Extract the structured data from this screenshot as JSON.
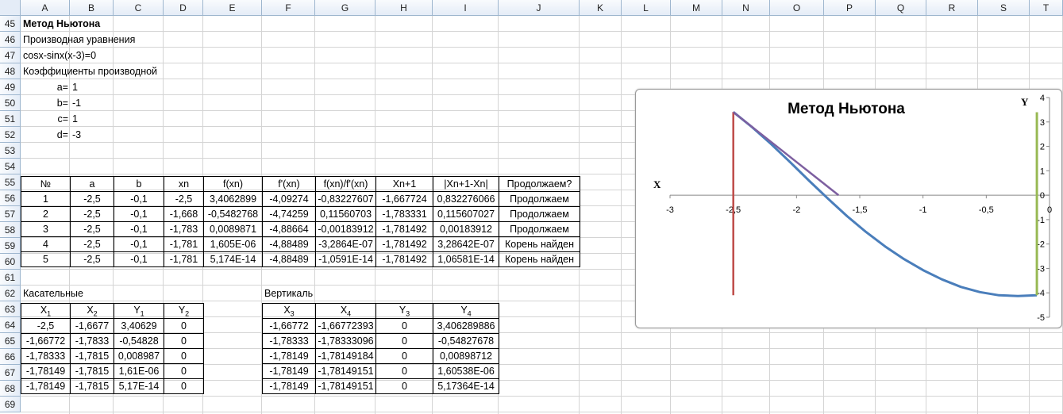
{
  "columns": [
    "A",
    "B",
    "C",
    "D",
    "E",
    "F",
    "G",
    "H",
    "I",
    "J",
    "K",
    "L",
    "M",
    "N",
    "O",
    "P",
    "Q",
    "R",
    "S",
    "T"
  ],
  "rows": [
    "45",
    "46",
    "47",
    "48",
    "49",
    "50",
    "51",
    "52",
    "53",
    "54",
    "55",
    "56",
    "57",
    "58",
    "59",
    "60",
    "61",
    "62",
    "63",
    "64",
    "65",
    "66",
    "67",
    "68",
    "69"
  ],
  "title": "Метод Ньютона",
  "derivative_label": "Производная уравнения",
  "equation": "cosx-sinx(x-3)=0",
  "coef_label": "Коэффициенты производной",
  "coefs": [
    {
      "name": "a=",
      "value": "1"
    },
    {
      "name": "b=",
      "value": "-1"
    },
    {
      "name": "c=",
      "value": "1"
    },
    {
      "name": "d=",
      "value": "-3"
    }
  ],
  "main_table": {
    "headers": [
      "№",
      "a",
      "b",
      "xn",
      "f(xn)",
      "f'(xn)",
      "f(xn)/f'(xn)",
      "Xn+1",
      "|Xn+1-Xn|",
      "Продолжаем?"
    ],
    "rows": [
      [
        "1",
        "-2,5",
        "-0,1",
        "-2,5",
        "3,4062899",
        "-4,09274",
        "-0,83227607",
        "-1,667724",
        "0,832276066",
        "Продолжаем"
      ],
      [
        "2",
        "-2,5",
        "-0,1",
        "-1,668",
        "-0,5482768",
        "-4,74259",
        "0,11560703",
        "-1,783331",
        "0,115607027",
        "Продолжаем"
      ],
      [
        "3",
        "-2,5",
        "-0,1",
        "-1,783",
        "0,0089871",
        "-4,88664",
        "-0,00183912",
        "-1,781492",
        "0,00183912",
        "Продолжаем"
      ],
      [
        "4",
        "-2,5",
        "-0,1",
        "-1,781",
        "1,605E-06",
        "-4,88489",
        "-3,2864E-07",
        "-1,781492",
        "3,28642E-07",
        "Корень найден"
      ],
      [
        "5",
        "-2,5",
        "-0,1",
        "-1,781",
        "5,174E-14",
        "-4,88489",
        "-1,0591E-14",
        "-1,781492",
        "1,06581E-14",
        "Корень найден"
      ]
    ]
  },
  "tangent_label": "Касательные",
  "tangent_table": {
    "headers": [
      [
        "X",
        "1"
      ],
      [
        "X",
        "2"
      ],
      [
        "Y",
        "1"
      ],
      [
        "Y",
        "2"
      ]
    ],
    "rows": [
      [
        "-2,5",
        "-1,6677",
        "3,40629",
        "0"
      ],
      [
        "-1,66772",
        "-1,7833",
        "-0,54828",
        "0"
      ],
      [
        "-1,78333",
        "-1,7815",
        "0,008987",
        "0"
      ],
      [
        "-1,78149",
        "-1,7815",
        "1,61E-06",
        "0"
      ],
      [
        "-1,78149",
        "-1,7815",
        "5,17E-14",
        "0"
      ]
    ]
  },
  "vertical_label": "Вертикаль",
  "vertical_table": {
    "headers": [
      [
        "X",
        "3"
      ],
      [
        "X",
        "4"
      ],
      [
        "Y",
        "3"
      ],
      [
        "Y",
        "4"
      ]
    ],
    "rows": [
      [
        "-1,66772",
        "-1,66772393",
        "0",
        "3,406289886"
      ],
      [
        "-1,78333",
        "-1,78333096",
        "0",
        "-0,54827678"
      ],
      [
        "-1,78149",
        "-1,78149184",
        "0",
        "0,00898712"
      ],
      [
        "-1,78149",
        "-1,78149151",
        "0",
        "1,60538E-06"
      ],
      [
        "-1,78149",
        "-1,78149151",
        "0",
        "5,17364E-14"
      ]
    ]
  },
  "chart_data": {
    "type": "line",
    "title": "Метод Ньютона",
    "xlabel": "X",
    "ylabel": "Y",
    "xlim": [
      -3,
      0
    ],
    "ylim": [
      -5,
      4
    ],
    "x_ticks": [
      "-3",
      "-2,5",
      "-2",
      "-1,5",
      "-1",
      "-0,5",
      "0"
    ],
    "y_ticks": [
      "4",
      "3",
      "2",
      "1",
      "0",
      "-1",
      "-2",
      "-3",
      "-4",
      "-5"
    ],
    "colors": {
      "curve": "#4a7ebb",
      "vertical": "#be4b48",
      "tangent": "#7d5fa0",
      "y_marker": "#98b954"
    },
    "series": [
      {
        "color": "#4a7ebb",
        "x": [
          -2.5,
          -2.35,
          -2.2,
          -2.05,
          -1.9,
          -1.75,
          -1.6,
          -1.45,
          -1.3,
          -1.15,
          -1.0,
          -0.85,
          -0.7,
          -0.55,
          -0.4,
          -0.25,
          -0.1
        ],
        "y": [
          3.41,
          2.78,
          2.09,
          1.35,
          0.59,
          -0.15,
          -0.86,
          -1.51,
          -2.1,
          -2.62,
          -3.07,
          -3.45,
          -3.76,
          -3.97,
          -4.1,
          -4.13,
          -4.1
        ]
      },
      {
        "color": "#be4b48",
        "x": [
          -2.5,
          -2.5
        ],
        "y": [
          3.41,
          -4.1
        ]
      },
      {
        "color": "#7d5fa0",
        "x": [
          -2.5,
          -1.6677
        ],
        "y": [
          3.406,
          0
        ]
      },
      {
        "color": "#98b954",
        "x": [
          -0.1,
          -0.1
        ],
        "y": [
          3.4,
          -4.1
        ]
      }
    ]
  }
}
